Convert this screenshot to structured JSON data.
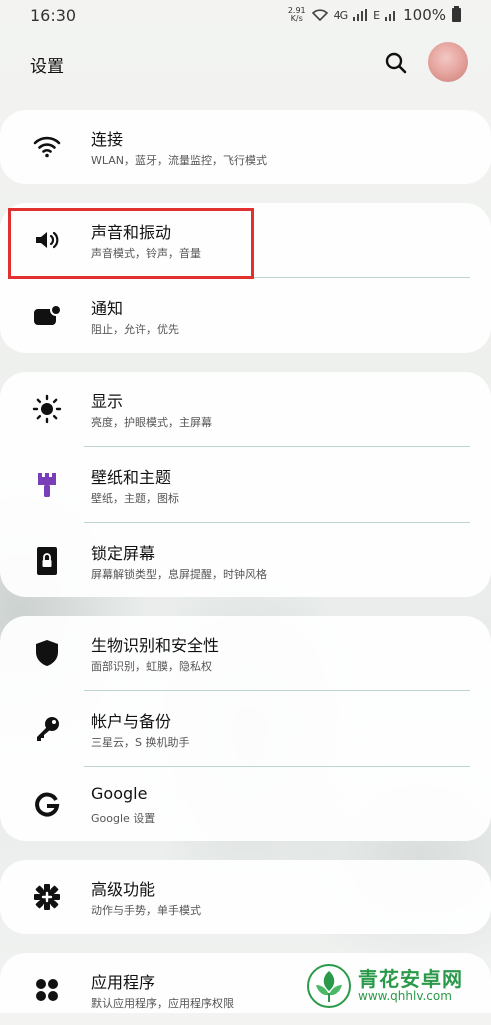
{
  "status_bar": {
    "time": "16:30",
    "net_speed_value": "2.91",
    "net_speed_unit": "K/s",
    "signal_4g": "4G",
    "signal_e": "E",
    "battery": "100%"
  },
  "header": {
    "title": "设置"
  },
  "groups": [
    {
      "items": [
        {
          "title": "连接",
          "subtitle": "WLAN，蓝牙，流量监控，飞行模式",
          "icon": "wifi-icon"
        }
      ]
    },
    {
      "items": [
        {
          "title": "声音和振动",
          "subtitle": "声音模式，铃声，音量",
          "icon": "speaker-icon"
        },
        {
          "title": "通知",
          "subtitle": "阻止，允许，优先",
          "icon": "notification-icon"
        }
      ]
    },
    {
      "items": [
        {
          "title": "显示",
          "subtitle": "亮度，护眼模式，主屏幕",
          "icon": "brightness-icon"
        },
        {
          "title": "壁纸和主题",
          "subtitle": "壁纸，主题，图标",
          "icon": "paint-brush-icon"
        },
        {
          "title": "锁定屏幕",
          "subtitle": "屏幕解锁类型，息屏提醒，时钟风格",
          "icon": "lock-icon"
        }
      ]
    },
    {
      "items": [
        {
          "title": "生物识别和安全性",
          "subtitle": "面部识别，虹膜，隐私权",
          "icon": "shield-icon"
        },
        {
          "title": "帐户与备份",
          "subtitle": "三星云，S 换机助手",
          "icon": "key-icon"
        },
        {
          "title": "Google",
          "subtitle": "Google 设置",
          "icon": "google-icon"
        }
      ]
    },
    {
      "items": [
        {
          "title": "高级功能",
          "subtitle": "动作与手势，单手模式",
          "icon": "gear-plus-icon"
        }
      ]
    },
    {
      "items": [
        {
          "title": "应用程序",
          "subtitle": "默认应用程序，应用程序权限",
          "icon": "apps-icon"
        }
      ]
    }
  ],
  "watermark": {
    "title": "青花安卓网",
    "url": "www.qhhlv.com"
  },
  "colors": {
    "highlight": "#e03030",
    "accent_purple": "#7a3fb8",
    "watermark_green": "#2a9a4a"
  }
}
